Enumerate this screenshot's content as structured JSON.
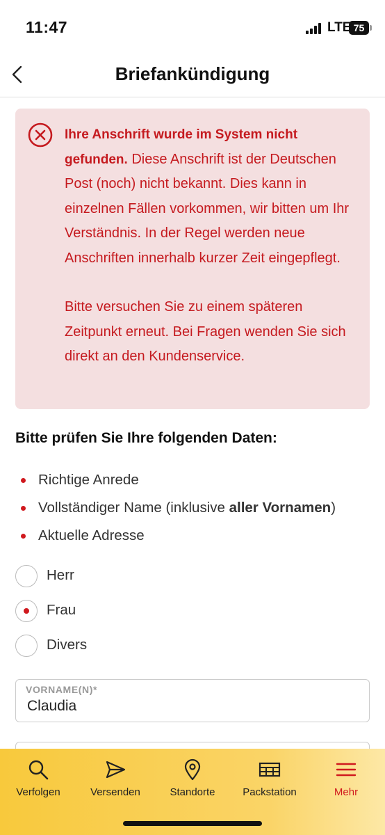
{
  "status_bar": {
    "time": "11:47",
    "network": "LTE",
    "battery": "75"
  },
  "header": {
    "title": "Briefankündigung"
  },
  "error": {
    "title": "Ihre Anschrift wurde im System nicht gefunden.",
    "message": "Diese Anschrift ist der Deutschen Post (noch) nicht bekannt. Dies kann in einzelnen Fällen vorkommen, wir bitten um Ihr Verständnis. In der Regel werden neue Anschriften innerhalb kurzer Zeit eingepflegt.",
    "hint": "Bitte versuchen Sie zu einem späteren Zeitpunkt erneut. Bei Fragen wenden Sie sich direkt an den Kundenservice."
  },
  "checklist": {
    "heading": "Bitte prüfen Sie Ihre folgenden Daten:",
    "items": [
      {
        "text": "Richtige Anrede"
      },
      {
        "text_before": "Vollständiger Name (inklusive ",
        "text_bold": "aller Vornamen",
        "text_after": ")"
      },
      {
        "text": "Aktuelle Adresse"
      }
    ]
  },
  "salutation": {
    "options": [
      "Herr",
      "Frau",
      "Divers"
    ],
    "selected": "Frau"
  },
  "form": {
    "firstname_label": "VORNAME(N)*",
    "firstname_value": "Claudia"
  },
  "tabbar": {
    "items": [
      {
        "label": "Verfolgen",
        "icon": "search-icon"
      },
      {
        "label": "Versenden",
        "icon": "send-icon"
      },
      {
        "label": "Standorte",
        "icon": "location-pin-icon"
      },
      {
        "label": "Packstation",
        "icon": "packstation-icon"
      },
      {
        "label": "Mehr",
        "icon": "menu-icon",
        "active": true
      }
    ]
  },
  "colors": {
    "accent": "#d0191e",
    "error_bg": "#f4dfe0",
    "tabbar_yellow": "#f8c93c"
  }
}
